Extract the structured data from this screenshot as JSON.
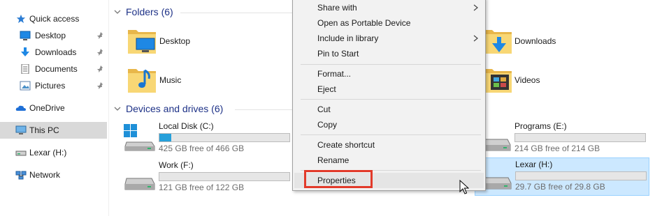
{
  "nav": {
    "quick_access": "Quick access",
    "items": [
      {
        "label": "Desktop",
        "icon": "desktop-icon"
      },
      {
        "label": "Downloads",
        "icon": "downloads-icon"
      },
      {
        "label": "Documents",
        "icon": "documents-icon"
      },
      {
        "label": "Pictures",
        "icon": "pictures-icon"
      }
    ],
    "onedrive": "OneDrive",
    "this_pc": "This PC",
    "lexar": "Lexar (H:)",
    "network": "Network"
  },
  "folders": {
    "header": "Folders (6)",
    "items": [
      "Desktop",
      "Downloads",
      "Music",
      "Videos"
    ]
  },
  "devices": {
    "header": "Devices and drives (6)",
    "drives": [
      {
        "name": "Local Disk (C:)",
        "free": "425 GB free of 466 GB",
        "used_fraction": 0.09
      },
      {
        "name": "Programs (E:)",
        "free": "214 GB free of 214 GB",
        "used_fraction": 0.0
      },
      {
        "name": "Work (F:)",
        "free": "121 GB free of 122 GB",
        "used_fraction": 0.0
      },
      {
        "name": "Lexar (H:)",
        "free": "29.7 GB free of 29.8 GB",
        "used_fraction": 0.0
      }
    ]
  },
  "context_menu": {
    "items": [
      "Share with",
      "Open as Portable Device",
      "Include in library",
      "Pin to Start",
      "Format...",
      "Eject",
      "Cut",
      "Copy",
      "Create shortcut",
      "Rename",
      "Properties"
    ]
  },
  "colors": {
    "accent": "#26a0da",
    "highlight_border": "#e23a2a",
    "group_header": "#1e3287",
    "selected_bg": "#cce8ff"
  }
}
